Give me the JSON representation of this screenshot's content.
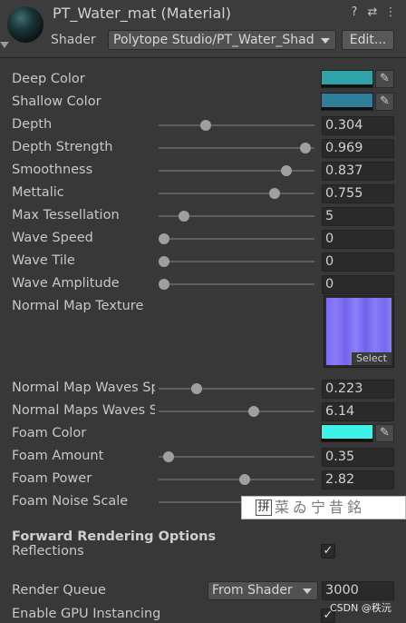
{
  "header": {
    "title": "PT_Water_mat (Material)",
    "shader_label": "Shader",
    "shader_value": "Polytope Studio/PT_Water_Shad",
    "edit_label": "Edit...",
    "icons": [
      "help-icon",
      "preset-icon",
      "more-icon"
    ]
  },
  "properties": {
    "deep_color": {
      "label": "Deep Color",
      "color": "#2fa3a8"
    },
    "shallow_color": {
      "label": "Shallow Color",
      "color": "#2f7f9a"
    },
    "depth": {
      "label": "Depth",
      "value": "0.304",
      "fraction": 0.304
    },
    "depth_strength": {
      "label": "Depth Strength",
      "value": "0.969",
      "fraction": 0.94
    },
    "smoothness": {
      "label": "Smoothness",
      "value": "0.837",
      "fraction": 0.82
    },
    "mettalic": {
      "label": "Mettalic",
      "value": "0.755",
      "fraction": 0.745
    },
    "max_tessellation": {
      "label": "Max Tessellation",
      "value": "5",
      "fraction": 0.16
    },
    "wave_speed": {
      "label": "Wave Speed",
      "value": "0",
      "fraction": 0.035
    },
    "wave_tile": {
      "label": "Wave Tile",
      "value": "0",
      "fraction": 0.035
    },
    "wave_amplitude": {
      "label": "Wave Amplitude",
      "value": "0",
      "fraction": 0.035
    },
    "normal_map_texture": {
      "label": "Normal Map Texture",
      "select_label": "Select"
    },
    "normal_map_waves_speed": {
      "label": "Normal Map Waves Sp",
      "value": "0.223",
      "fraction": 0.245
    },
    "normal_maps_waves_size": {
      "label": "Normal Maps Waves S",
      "value": "6.14",
      "fraction": 0.61
    },
    "foam_color": {
      "label": "Foam Color",
      "color": "#3df2e6"
    },
    "foam_amount": {
      "label": "Foam Amount",
      "value": "0.35",
      "fraction": 0.065
    },
    "foam_power": {
      "label": "Foam Power",
      "value": "2.82",
      "fraction": 0.55
    },
    "foam_noise_scale": {
      "label": "Foam Noise Scale"
    }
  },
  "forward": {
    "section_title": "Forward Rendering Options",
    "reflections_label": "Reflections",
    "reflections_checked": "✓"
  },
  "render_queue": {
    "label": "Render Queue",
    "dropdown": "From Shader",
    "value": "3000"
  },
  "gpu_instancing": {
    "label": "Enable GPU Instancing",
    "checked": "✓"
  },
  "ime_overlay": {
    "box_char": "拼",
    "text": "菜ゐ宁昔銘"
  },
  "watermark": "CSDN @秩沅"
}
